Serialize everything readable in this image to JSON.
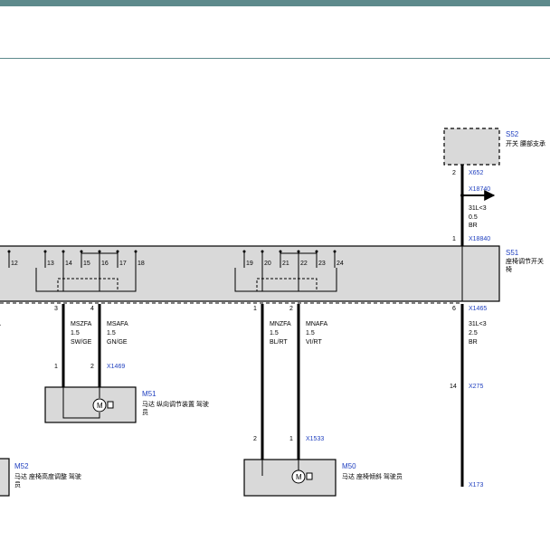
{
  "colors": {
    "header": "#5e8a8c",
    "connector_label": "#1f3fbf",
    "wire": "#000000",
    "module_fill": "#d9d9d9"
  },
  "s52": {
    "id": "S52",
    "desc": "开关 腰部支承",
    "pin": "2",
    "conn": "X652",
    "splice": "X18740",
    "wire_code": "31L<3",
    "wire_size": "0.5",
    "wire_color": "BR"
  },
  "s51": {
    "id": "S51",
    "desc_line1": "座椅调节开关",
    "desc_line2": "椅",
    "top_pin": "1",
    "top_conn": "X18840",
    "pins_left": [
      "12",
      "13",
      "14",
      "15",
      "16",
      "17",
      "18"
    ],
    "pins_right": [
      "19",
      "20",
      "21",
      "22",
      "23",
      "24"
    ]
  },
  "wires": {
    "left_cut": "A",
    "msz": {
      "pin": "3",
      "name": "MSZFA",
      "size": "1.5",
      "color": "SW/GE"
    },
    "msa": {
      "pin": "4",
      "name": "MSAFA",
      "size": "1.5",
      "color": "GN/GE"
    },
    "mnz": {
      "pin": "1",
      "name": "MNZFA",
      "size": "1.5",
      "color": "BL/RT"
    },
    "mna": {
      "pin": "2",
      "name": "MNAFA",
      "size": "1.5",
      "color": "VI/RT"
    },
    "gnd": {
      "pin": "6",
      "conn": "X1465",
      "code": "31L<3",
      "size": "2.5",
      "color": "BR"
    }
  },
  "m51": {
    "id": "M51",
    "desc_line1": "马达 纵向调节装置 驾驶",
    "desc_line2": "员",
    "pin_a": "1",
    "pin_b": "2",
    "conn": "X1469"
  },
  "m50": {
    "id": "M50",
    "desc": "马达 座椅倾斜 驾驶员",
    "pin_a": "2",
    "pin_b": "1",
    "conn": "X1533"
  },
  "m52": {
    "id": "M52",
    "desc_line1": "马达 座椅高度调整 驾驶",
    "desc_line2": "员"
  },
  "ground": {
    "pin": "14",
    "conn": "X275",
    "end_conn": "X173"
  }
}
